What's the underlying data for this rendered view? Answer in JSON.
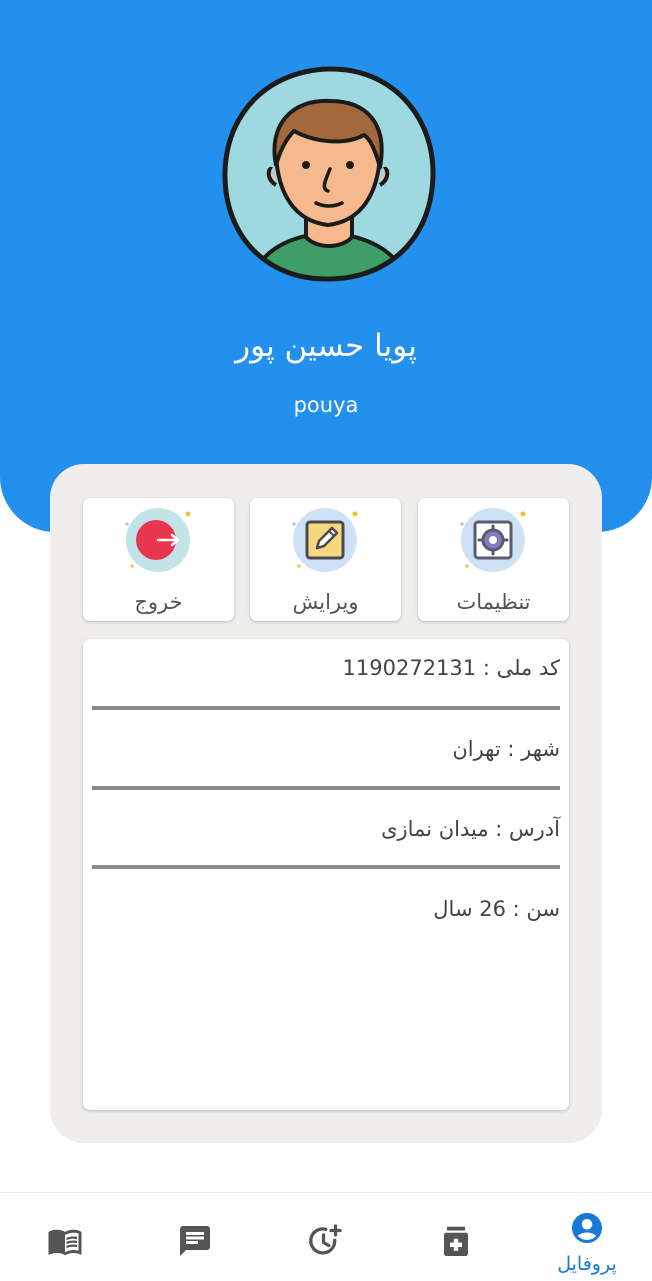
{
  "profile": {
    "full_name": "پویا حسین پور",
    "username": "pouya",
    "avatar_icon": "user-avatar-illustration"
  },
  "actions": [
    {
      "label": "تنظیمات",
      "icon": "settings-icon"
    },
    {
      "label": "ویرایش",
      "icon": "edit-icon"
    },
    {
      "label": "خروج",
      "icon": "logout-icon"
    }
  ],
  "info": {
    "national_code_label": "کد ملی :",
    "national_code_value": "1190272131",
    "city_label": "شهر :",
    "city_value": "تهران",
    "address_label": "آدرس :",
    "address_value": "میدان نمازی",
    "age_label": "سن :",
    "age_value": "26 سال"
  },
  "nav": {
    "items": [
      {
        "icon": "book-icon",
        "label": ""
      },
      {
        "icon": "chat-icon",
        "label": ""
      },
      {
        "icon": "history-add-icon",
        "label": ""
      },
      {
        "icon": "medicine-icon",
        "label": ""
      },
      {
        "icon": "profile-icon",
        "label": "پروفایل"
      }
    ],
    "active_index": 4
  },
  "colors": {
    "primary": "#2290ec",
    "panel_bg": "#efeeec",
    "logout_red": "#e8364f",
    "nav_active": "#1a78d8",
    "nav_inactive": "#555555"
  }
}
